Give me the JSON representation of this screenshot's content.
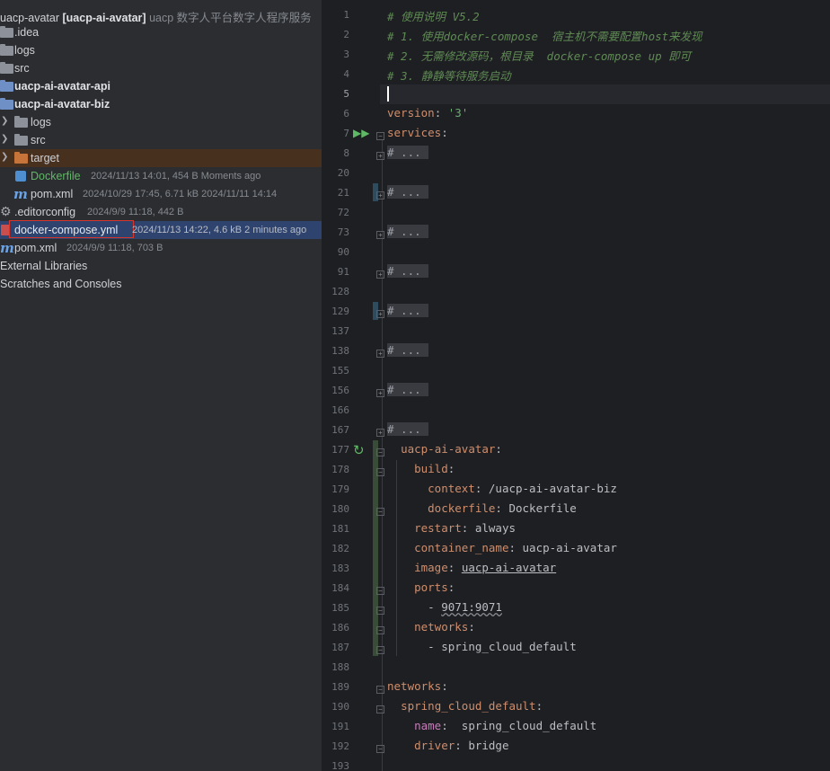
{
  "project_tree": {
    "rows": [
      {
        "label": "uacp-avatar",
        "label_bold": "[uacp-ai-avatar]",
        "meta": "uacp 数字人平台数字人程序服务"
      },
      {
        "label": ".idea"
      },
      {
        "label": "logs"
      },
      {
        "label": "src"
      },
      {
        "label": "uacp-ai-avatar-api"
      },
      {
        "label": "uacp-ai-avatar-biz"
      },
      {
        "label": "logs"
      },
      {
        "label": "src"
      },
      {
        "label": "target"
      },
      {
        "label": "Dockerfile",
        "meta": "2024/11/13 14:01, 454 B Moments ago"
      },
      {
        "label": "pom.xml",
        "meta": "2024/10/29 17:45, 6.71 kB 2024/11/11 14:14"
      },
      {
        "label": ".editorconfig",
        "meta": "2024/9/9 11:18, 442 B"
      },
      {
        "label": "docker-compose.yml",
        "meta": "2024/11/13 14:22, 4.6 kB 2 minutes ago"
      },
      {
        "label": "pom.xml",
        "meta": "2024/9/9 11:18, 703 B"
      },
      {
        "label": "External Libraries"
      },
      {
        "label": "Scratches and Consoles"
      }
    ]
  },
  "icons": {
    "folder": "folder-icon",
    "module": "module-folder-icon",
    "excluded": "excluded-folder-icon",
    "maven": "maven-pom-icon",
    "docker": "dockerfile-icon",
    "config": "gear-icon",
    "yaml": "yaml-file-icon",
    "run": "run-services-icon",
    "rerun": "rerun-icon"
  },
  "editor": {
    "line_numbers": [
      "1",
      "2",
      "3",
      "4",
      "5",
      "6",
      "7",
      "8",
      "20",
      "21",
      "72",
      "73",
      "90",
      "91",
      "128",
      "129",
      "137",
      "138",
      "155",
      "156",
      "166",
      "167",
      "177",
      "178",
      "179",
      "180",
      "181",
      "182",
      "183",
      "184",
      "185",
      "186",
      "187",
      "188",
      "189",
      "190",
      "191",
      "192",
      "193"
    ],
    "lines": {
      "l1": "# 使用说明 V5.2",
      "l2": "# 1. 使用docker-compose  宿主机不需要配置host来发现",
      "l3": "# 2. 无需修改源码，根目录  docker-compose up 即可",
      "l4": "# 3. 静静等待服务启动",
      "l6_key": "version",
      "l6_val": "'3'",
      "l7_key": "services",
      "folded": "# ...",
      "l177_key": "uacp-ai-avatar",
      "l178_key": "build",
      "l179_key": "context",
      "l179_val": "/uacp-ai-avatar-biz",
      "l180_key": "dockerfile",
      "l180_val": "Dockerfile",
      "l181_key": "restart",
      "l181_val": "always",
      "l182_key": "container_name",
      "l182_val": "uacp-ai-avatar",
      "l183_key": "image",
      "l183_val": "uacp-ai-avatar",
      "l184_key": "ports",
      "l185_val": "9071:9071",
      "l186_key": "networks",
      "l187_val": "spring_cloud_default",
      "l189_key": "networks",
      "l190_key": "spring_cloud_default",
      "l191_key": "name",
      "l191_val": "spring_cloud_default",
      "l192_key": "driver",
      "l192_val": "bridge"
    }
  },
  "colors": {
    "comment": "#5f8a55",
    "key": "#cf8e6d",
    "string": "#6aab73",
    "selection": "#2e436e",
    "highlight_border": "#d9352b"
  }
}
